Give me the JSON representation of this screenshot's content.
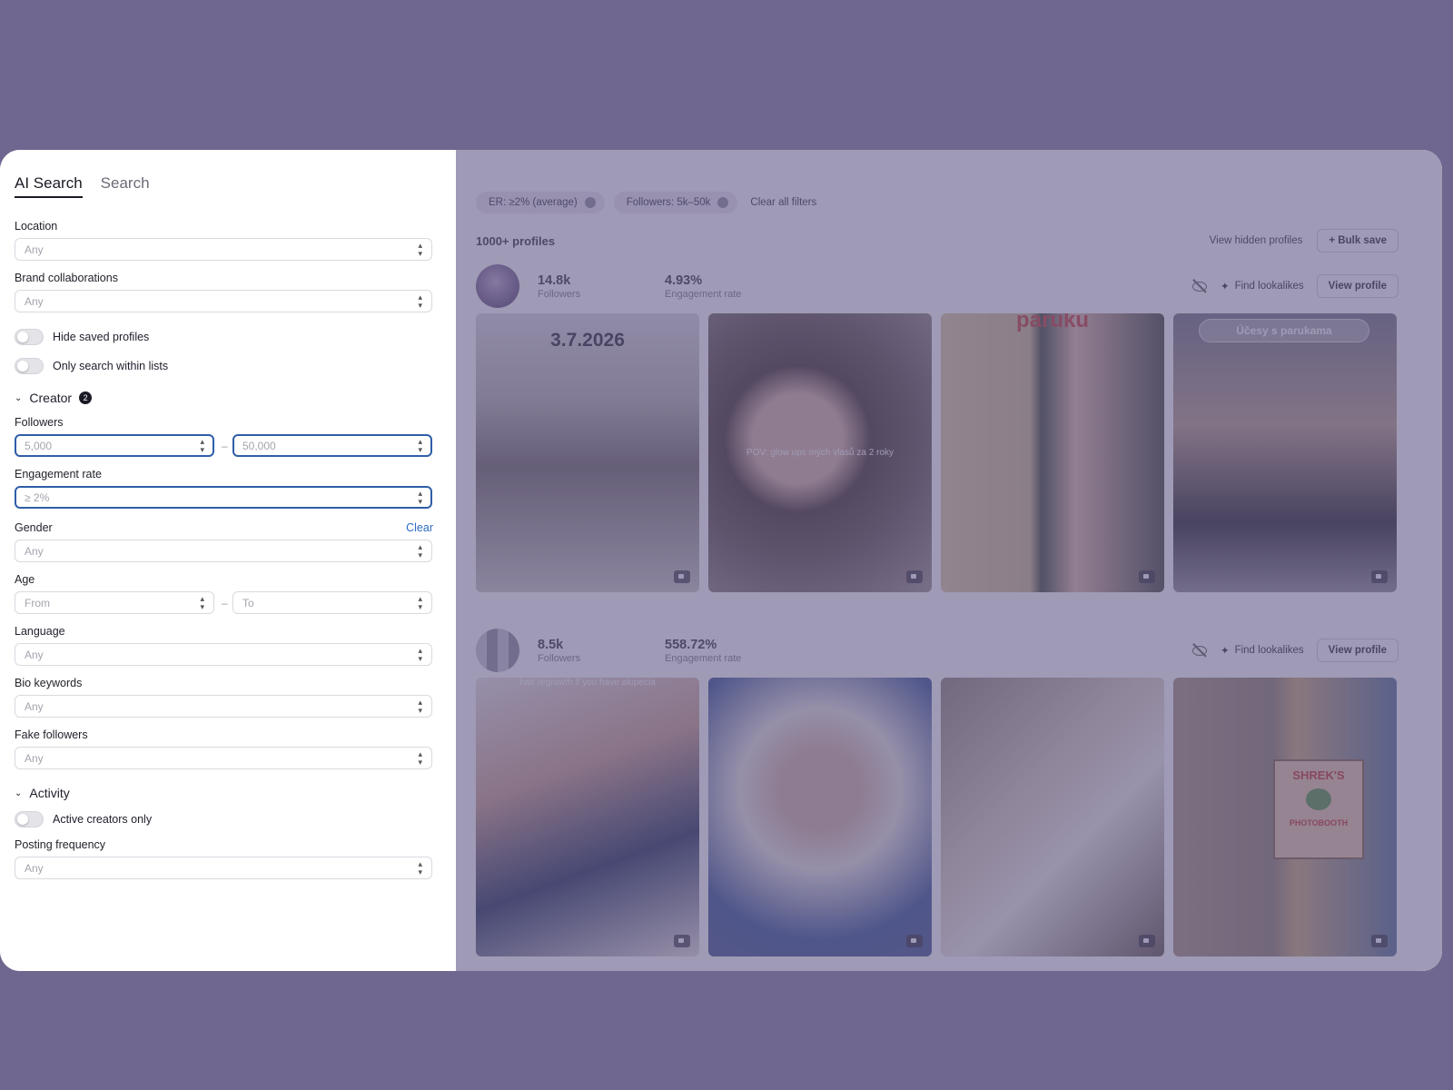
{
  "tabs": [
    "AI Search",
    "Search"
  ],
  "filters": {
    "location": {
      "label": "Location",
      "value": "Any"
    },
    "brand": {
      "label": "Brand collaborations",
      "value": "Any"
    },
    "hide_saved": "Hide saved profiles",
    "within_lists": "Only search within lists",
    "creator_section": "Creator",
    "creator_badge": "2",
    "followers": {
      "label": "Followers",
      "from": "5,000",
      "dash": "–",
      "to": "50,000"
    },
    "engagement": {
      "label": "Engagement rate",
      "value": "≥ 2%"
    },
    "gender": {
      "label": "Gender",
      "clear": "Clear",
      "value": "Any"
    },
    "age": {
      "label": "Age",
      "from": "From",
      "dash": "–",
      "to": "To"
    },
    "language": {
      "label": "Language",
      "value": "Any"
    },
    "bio": {
      "label": "Bio keywords",
      "value": "Any"
    },
    "fake": {
      "label": "Fake followers",
      "value": "Any"
    },
    "activity_section": "Activity",
    "active_only": "Active creators only",
    "posting": {
      "label": "Posting frequency",
      "value": "Any"
    }
  },
  "chips": [
    "ER: ≥2% (average)",
    "Followers: 5k–50k"
  ],
  "clear_all": "Clear all filters",
  "count": "1000+ profiles",
  "view_hidden": "View hidden profiles",
  "bulk_save": "+ Bulk save",
  "find_lookalikes": "Find lookalikes",
  "view_profile": "View profile",
  "profiles": [
    {
      "followers": "14.8k",
      "followers_label": "Followers",
      "er": "4.93%",
      "er_label": "Engagement rate",
      "overlays": {
        "date": "3.7.2026",
        "caption": "POV: glow ups mých vlasů za 2 roky",
        "title": "paruku",
        "search": "Účesy s parukama"
      }
    },
    {
      "followers": "8.5k",
      "followers_label": "Followers",
      "er": "558.72%",
      "er_label": "Engagement rate",
      "overlays": {
        "caption": "hair regrowth if you have alopecia",
        "sign_top": "SHREK'S",
        "sign_bottom": "PHOTOBOOTH"
      }
    }
  ]
}
